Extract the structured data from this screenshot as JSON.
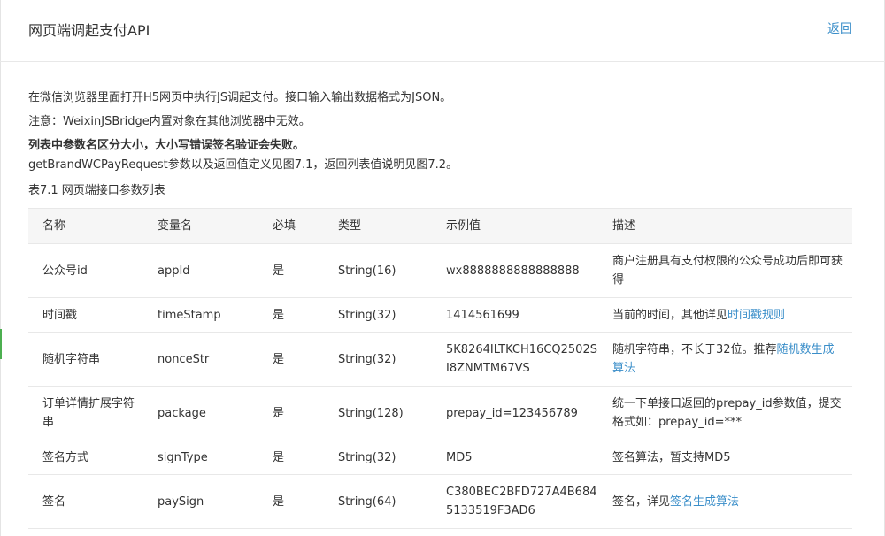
{
  "header": {
    "title": "网页端调起支付API",
    "back_label": "返回"
  },
  "intro": {
    "line1": "在微信浏览器里面打开H5网页中执行JS调起支付。接口输入输出数据格式为JSON。",
    "line2": "注意：WeixinJSBridge内置对象在其他浏览器中无效。",
    "line3": "列表中参数名区分大小，大小写错误签名验证会失败。",
    "line4": "getBrandWCPayRequest参数以及返回值定义见图7.1，返回列表值说明见图7.2。",
    "caption": "表7.1 网页端接口参数列表"
  },
  "table": {
    "headers": [
      "名称",
      "变量名",
      "必填",
      "类型",
      "示例值",
      "描述"
    ],
    "rows": [
      {
        "name": "公众号id",
        "var": "appId",
        "required": "是",
        "type": "String(16)",
        "example": "wx8888888888888888",
        "desc": "商户注册具有支付权限的公众号成功后即可获得",
        "desc_link": ""
      },
      {
        "name": "时间戳",
        "var": "timeStamp",
        "required": "是",
        "type": "String(32)",
        "example": "1414561699",
        "desc": "当前的时间，其他详见",
        "desc_link": "时间戳规则"
      },
      {
        "name": "随机字符串",
        "var": "nonceStr",
        "required": "是",
        "type": "String(32)",
        "example": "5K8264ILTKCH16CQ2502SI8ZNMTM67VS",
        "desc": "随机字符串，不长于32位。推荐",
        "desc_link": "随机数生成算法"
      },
      {
        "name": "订单详情扩展字符串",
        "var": "package",
        "required": "是",
        "type": "String(128)",
        "example": "prepay_id=123456789",
        "desc": "统一下单接口返回的prepay_id参数值，提交格式如：prepay_id=***",
        "desc_link": ""
      },
      {
        "name": "签名方式",
        "var": "signType",
        "required": "是",
        "type": "String(32)",
        "example": "MD5",
        "desc": "签名算法，暂支持MD5",
        "desc_link": ""
      },
      {
        "name": "签名",
        "var": "paySign",
        "required": "是",
        "type": "String(64)",
        "example": "C380BEC2BFD727A4B6845133519F3AD6",
        "desc": "签名，详见",
        "desc_link": "签名生成算法"
      }
    ]
  }
}
